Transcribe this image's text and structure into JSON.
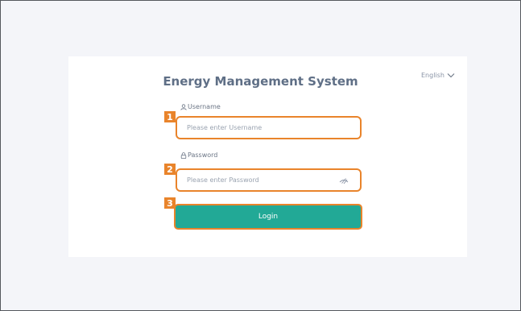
{
  "app": {
    "title": "Energy Management System",
    "language": "English"
  },
  "form": {
    "username": {
      "label": "Username",
      "placeholder": "Please enter Username",
      "icon": "user-icon"
    },
    "password": {
      "label": "Password",
      "placeholder": "Please enter Password",
      "icon": "lock-icon",
      "toggle_icon": "eye-slash-icon"
    },
    "login_label": "Login"
  },
  "callouts": [
    "1",
    "2",
    "3"
  ],
  "colors": {
    "accent_orange": "#e9842b",
    "button_teal": "#22a996",
    "title_text": "#5f6f86",
    "background": "#f4f5f9"
  }
}
